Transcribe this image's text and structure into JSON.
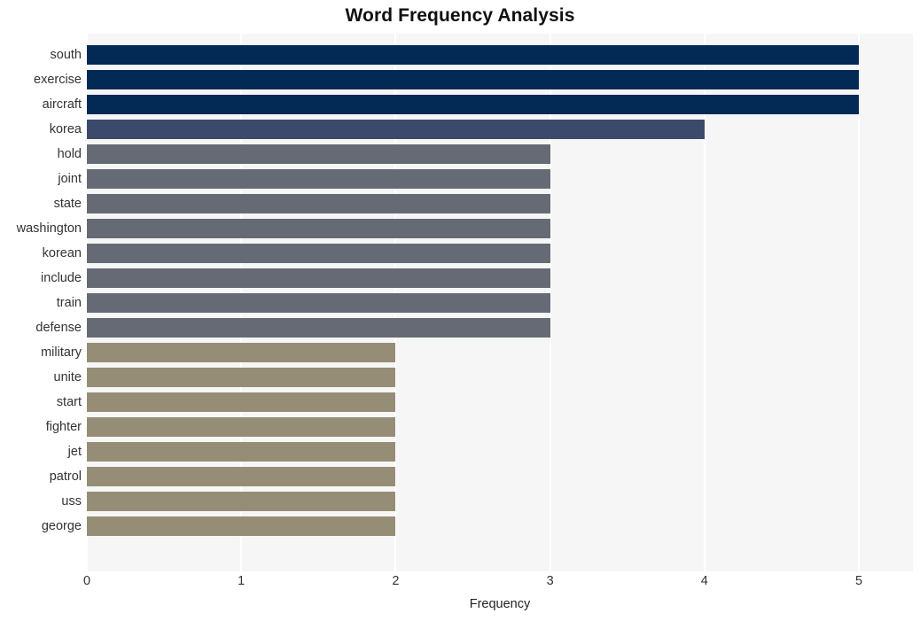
{
  "chart_data": {
    "type": "bar",
    "orientation": "horizontal",
    "title": "Word Frequency Analysis",
    "xlabel": "Frequency",
    "ylabel": "",
    "xlim": [
      0,
      5.35
    ],
    "xticks": [
      0,
      1,
      2,
      3,
      4,
      5
    ],
    "xtick_labels": [
      "0",
      "1",
      "2",
      "3",
      "4",
      "5"
    ],
    "grid": "vertical-and-horizontal-white-on-light-gray",
    "legend": "none",
    "categories": [
      "south",
      "exercise",
      "aircraft",
      "korea",
      "hold",
      "joint",
      "state",
      "washington",
      "korean",
      "include",
      "train",
      "defense",
      "military",
      "unite",
      "start",
      "fighter",
      "jet",
      "patrol",
      "uss",
      "george"
    ],
    "values": [
      5,
      5,
      5,
      4,
      3,
      3,
      3,
      3,
      3,
      3,
      3,
      3,
      2,
      2,
      2,
      2,
      2,
      2,
      2,
      2
    ],
    "bar_colors": [
      "#032a55",
      "#032a55",
      "#032a55",
      "#3b4a6b",
      "#666a74",
      "#666a74",
      "#666a74",
      "#666a74",
      "#666a74",
      "#666a74",
      "#666a74",
      "#666a74",
      "#968d76",
      "#968d76",
      "#968d76",
      "#968d76",
      "#968d76",
      "#968d76",
      "#968d76",
      "#968d76"
    ]
  },
  "style": {
    "plot_background": "#f6f6f7",
    "gridline_color": "#ffffff",
    "figure_background": "#ffffff",
    "title_color": "#111111",
    "tick_label_color": "#333333"
  }
}
